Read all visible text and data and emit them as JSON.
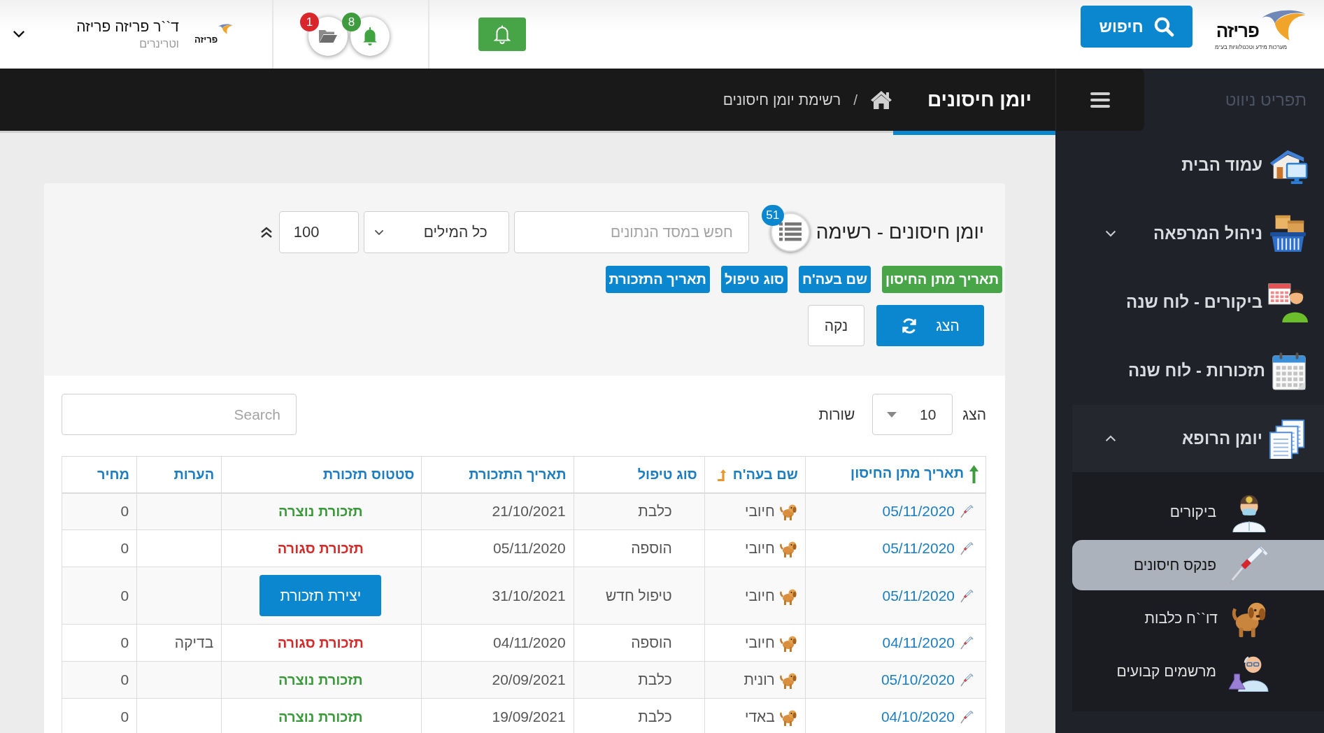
{
  "header": {
    "logo": {
      "name": "פריזה",
      "tagline": "מערכות מידע וטכנולוגיות בע\"מ"
    },
    "search_button": "חיפוש",
    "notifications": [
      {
        "count": "8",
        "color": "#3e9c3e"
      },
      {
        "count": "1",
        "color": "#d9262b"
      }
    ],
    "user": {
      "logo": "פריזה",
      "name": "ד``ר פריזה פריזה",
      "role": "וטרינרים"
    }
  },
  "sidebar": {
    "title": "תפריט ניווט",
    "items": [
      {
        "kind": "link",
        "label": "עמוד הבית"
      },
      {
        "kind": "group",
        "label": "ניהול המרפאה",
        "expanded": false
      },
      {
        "kind": "link",
        "label": "ביקורים - לוח שנה"
      },
      {
        "kind": "link",
        "label": "תזכורות - לוח שנה"
      },
      {
        "kind": "group",
        "label": "יומן הרופא",
        "expanded": true,
        "children": [
          {
            "label": "ביקורים",
            "selected": false
          },
          {
            "label": "פנקס חיסונים",
            "selected": true
          },
          {
            "label": "דו``ח כלבות",
            "selected": false
          },
          {
            "label": "מרשמים קבועים",
            "selected": false
          }
        ]
      }
    ]
  },
  "page": {
    "title": "יומן חיסונים",
    "breadcrumb": {
      "separator": "/",
      "current": "רשימת יומן חיסונים"
    }
  },
  "filter_panel": {
    "title": "יומן חיסונים - רשימה",
    "record_count": "51",
    "search": {
      "placeholder": "חפש במסד הנתונים"
    },
    "match_mode": "כל המילים",
    "limit": "100",
    "sort_tags": [
      {
        "label": "תאריך מתן החיסון",
        "selected": true
      },
      {
        "label": "שם בעה'ח",
        "selected": false
      },
      {
        "label": "סוג טיפול",
        "selected": false
      },
      {
        "label": "תאריך התזכורת",
        "selected": false
      }
    ],
    "buttons": [
      {
        "kind": "show",
        "label": "הצג"
      },
      {
        "kind": "clear",
        "label": "נקה"
      }
    ]
  },
  "table": {
    "page_size": {
      "before": "הצג",
      "value": "10",
      "after": "שורות"
    },
    "search": {
      "placeholder": "Search"
    },
    "columns": [
      {
        "label": "תאריך מתן החיסון",
        "kind": "primary"
      },
      {
        "label": "שם בעה'ח",
        "kind": "secondary"
      },
      {
        "label": "סוג טיפול",
        "kind": "plain"
      },
      {
        "label": "תאריך התזכורת",
        "kind": "plain"
      },
      {
        "label": "סטטוס תזכורת",
        "kind": "plain"
      },
      {
        "label": "הערות",
        "kind": "plain"
      },
      {
        "label": "מחיר",
        "kind": "plain"
      }
    ],
    "rows": [
      {
        "date": "05/11/2020",
        "owner": "חיובי",
        "treatment": "כלבת",
        "reminder_date": "21/10/2021",
        "status": {
          "kind": "label",
          "text": "תזכורת נוצרה",
          "color": "#3a9a3a"
        },
        "price": "0"
      },
      {
        "date": "05/11/2020",
        "owner": "חיובי",
        "treatment": "הוספה",
        "reminder_date": "05/11/2020",
        "status": {
          "kind": "label",
          "text": "תזכורת סגורה",
          "color": "#d42a2a"
        },
        "price": "0"
      },
      {
        "date": "05/11/2020",
        "owner": "חיובי",
        "treatment": "טיפול חדש",
        "reminder_date": "31/10/2021",
        "status": {
          "kind": "button",
          "text": "יצירת תזכורת"
        },
        "price": "0"
      },
      {
        "date": "04/11/2020",
        "owner": "חיובי",
        "treatment": "הוספה",
        "reminder_date": "04/11/2020",
        "status": {
          "kind": "label",
          "text": "תזכורת סגורה",
          "color": "#d42a2a"
        },
        "notes": "בדיקה",
        "price": "0"
      },
      {
        "date": "05/10/2020",
        "owner": "רונית",
        "treatment": "כלבת",
        "reminder_date": "20/09/2021",
        "status": {
          "kind": "label",
          "text": "תזכורת נוצרה",
          "color": "#3a9a3a"
        },
        "price": "0"
      },
      {
        "date": "04/10/2020",
        "owner": "באדי",
        "treatment": "כלבת",
        "reminder_date": "19/09/2021",
        "status": {
          "kind": "label",
          "text": "תזכורת נוצרה",
          "color": "#3a9a3a"
        },
        "price": "0"
      }
    ]
  }
}
